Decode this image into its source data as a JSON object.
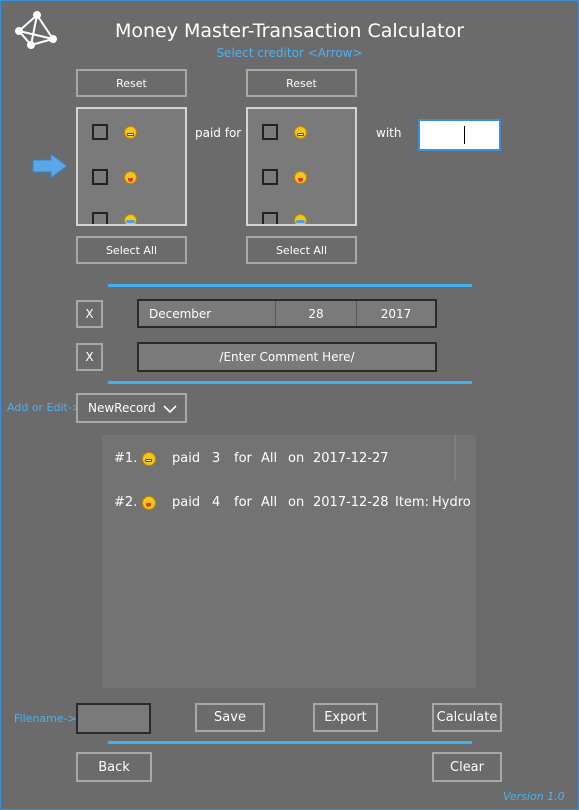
{
  "app": {
    "title": "Money Master-Transaction Calculator",
    "subtitle": "Select creditor <Arrow>",
    "version": "Version 1.0",
    "accent_color": "#3fb1f2"
  },
  "payers": {
    "reset_label": "Reset",
    "select_all_label": "Select All",
    "paid_for_label": "paid for",
    "with_label": "with",
    "amount_value": "",
    "items": [
      {
        "icon": "grimacing-emoji-icon",
        "checked": false
      },
      {
        "icon": "tongue-emoji-icon",
        "checked": false
      },
      {
        "icon": "crying-emoji-icon",
        "checked": false
      }
    ]
  },
  "beneficiaries": {
    "reset_label": "Reset",
    "select_all_label": "Select All",
    "items": [
      {
        "icon": "grimacing-emoji-icon",
        "checked": false
      },
      {
        "icon": "tongue-emoji-icon",
        "checked": false
      },
      {
        "icon": "crying-emoji-icon",
        "checked": false
      }
    ]
  },
  "date": {
    "clear_label": "X",
    "month": "December",
    "day": "28",
    "year": "2017"
  },
  "comment": {
    "clear_label": "X",
    "value": "/Enter Comment Here/"
  },
  "record": {
    "label": "Add or Edit->",
    "selected": "NewRecord"
  },
  "transactions": [
    {
      "index": "#1.",
      "icon": "grimacing-emoji-icon",
      "paid": "paid",
      "amount": "3",
      "for": "for",
      "who": "All",
      "on": "on",
      "date": "2017-12-27",
      "item_label": "",
      "item": ""
    },
    {
      "index": "#2.",
      "icon": "tongue-emoji-icon",
      "paid": "paid",
      "amount": "4",
      "for": "for",
      "who": "All",
      "on": "on",
      "date": "2017-12-28",
      "item_label": "Item:",
      "item": "Hydro"
    }
  ],
  "file": {
    "label": "Filename->",
    "value": "",
    "save_label": "Save",
    "export_label": "Export",
    "calculate_label": "Calculate"
  },
  "footer": {
    "back_label": "Back",
    "clear_label": "Clear"
  }
}
